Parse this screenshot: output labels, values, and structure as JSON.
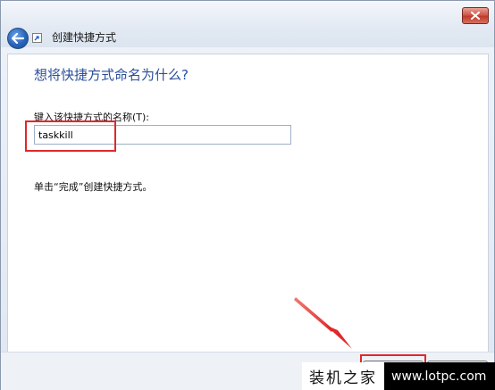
{
  "window": {
    "title": "创建快捷方式"
  },
  "wizard": {
    "heading": "想将快捷方式命名为什么?",
    "field_label": "键入该快捷方式的名称(T):",
    "name_value": "taskkill",
    "instruction": "单击“完成”创建快捷方式。"
  },
  "annotations": {
    "highlight_color": "#e0282a",
    "arrow_color": "#e0282a"
  },
  "watermark": {
    "brand": "装机之家",
    "url": "www.lotpc.com"
  },
  "icons": {
    "close": "close-icon",
    "back": "back-arrow-icon",
    "wizard": "shortcut-icon"
  }
}
